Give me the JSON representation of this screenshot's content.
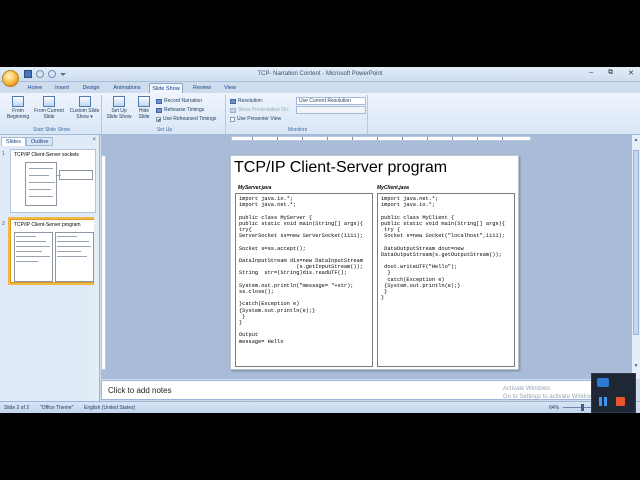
{
  "window": {
    "title": "TCP- Narration Content - Microsoft PowerPoint",
    "controls": [
      "–",
      "⧉",
      "✕"
    ]
  },
  "tabs": [
    {
      "label": "Home"
    },
    {
      "label": "Insert"
    },
    {
      "label": "Design"
    },
    {
      "label": "Animations"
    },
    {
      "label": "Slide Show",
      "active": true
    },
    {
      "label": "Review"
    },
    {
      "label": "View"
    }
  ],
  "ribbon": {
    "start_slide_show": {
      "group_label": "Start Slide Show",
      "from_beginning": "From Beginning",
      "from_current": "From Current Slide",
      "custom_show": "Custom Slide Show ▾"
    },
    "set_up": {
      "group_label": "Set Up",
      "set_up_show": "Set Up Slide Show",
      "hide_slide": "Hide Slide",
      "record_narration": "Record Narration",
      "rehearse_timings": "Rehearse Timings",
      "use_rehearsed": "Use Rehearsed Timings",
      "use_rehearsed_checked": true
    },
    "monitors": {
      "group_label": "Monitors",
      "resolution_label": "Resolution:",
      "resolution_value": "Use Current Resolution",
      "show_on_label": "Show Presentation On:",
      "presenter_view": "Use Presenter View"
    }
  },
  "left_pane": {
    "tabs": [
      "Slides",
      "Outline"
    ],
    "close": "×",
    "slides": [
      {
        "number": "1",
        "title": "TCP/IP Client-Server sockets"
      },
      {
        "number": "2",
        "title": "TCP/IP Client-Server program"
      }
    ]
  },
  "slide": {
    "title": "TCP/IP Client-Server program",
    "left_caption": "MyServer.java",
    "right_caption": "MyClient.java",
    "server_code": [
      "import java.io.*;",
      "import java.net.*;",
      "",
      "public class MyServer {",
      "public static void main(String[] args){",
      "try{",
      "ServerSocket ss=new ServerSocket(1111);",
      "",
      "Socket s=ss.accept();",
      "",
      "DataInputStream dis=new DataInputStream",
      "                  (s.getInputStream());",
      "String  str=(String)dis.readUTF();",
      "",
      "System.out.println(\"message= \"+str);",
      "ss.close();",
      "",
      "}catch(Exception e)",
      "{System.out.println(e);}",
      " }",
      "}",
      "",
      "Output",
      "message= Hello"
    ],
    "client_code": [
      "import java.net.*;",
      "import java.io.*;",
      "",
      "public class MyClient {",
      "public static void main(String[] args){",
      " try {",
      " Socket s=new Socket(\"localhost\",1111);",
      "",
      " DataOutputStream dout=new",
      "DataOutputStream(s.getOutputStream());",
      "",
      " dout.writeUTF(\"Hello\");",
      "  }",
      "  catch(Exception e)",
      " {System.out.println(e);}",
      " }",
      "}"
    ]
  },
  "notes": {
    "placeholder": "Click to add notes"
  },
  "watermark": {
    "line1": "Activate Windows",
    "line2": "Go to Settings to activate Windows."
  },
  "status": {
    "slide": "Slide 2 of 2",
    "theme": "\"Office Theme\"",
    "language": "English (United States)",
    "zoom": "64%"
  },
  "recorder": {
    "camera": "camera-icon"
  }
}
